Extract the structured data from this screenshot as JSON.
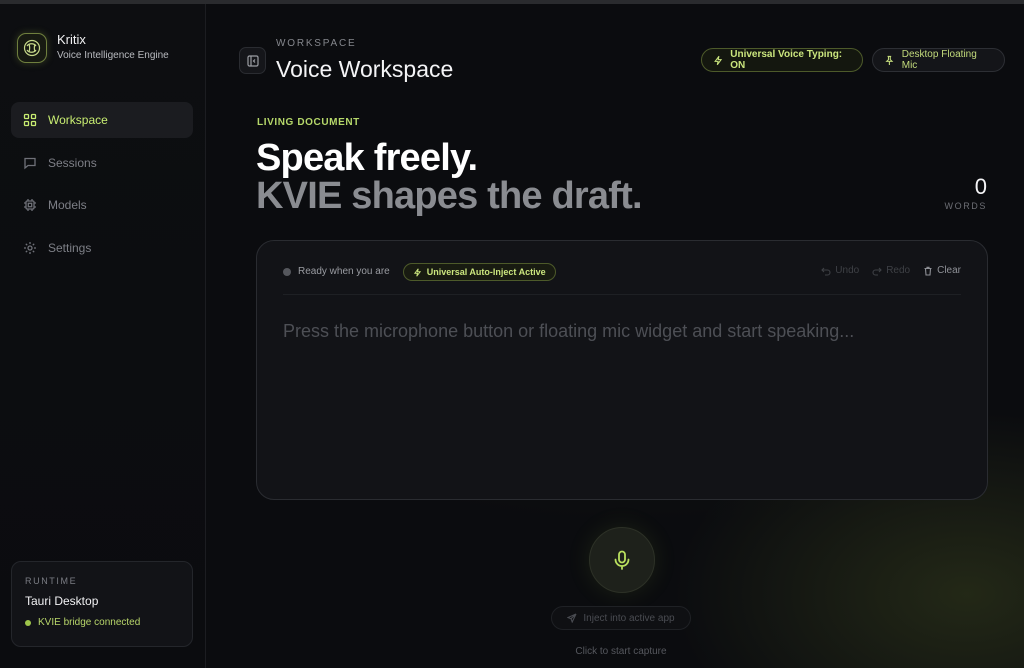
{
  "brand": {
    "name": "Kritix",
    "subtitle": "Voice Intelligence Engine"
  },
  "sidebar": {
    "items": [
      {
        "label": "Workspace",
        "icon": "grid-icon",
        "active": true
      },
      {
        "label": "Sessions",
        "icon": "chat-icon",
        "active": false
      },
      {
        "label": "Models",
        "icon": "chip-icon",
        "active": false
      },
      {
        "label": "Settings",
        "icon": "gear-icon",
        "active": false
      }
    ]
  },
  "runtime": {
    "label": "RUNTIME",
    "title": "Tauri Desktop",
    "status": "KVIE bridge connected"
  },
  "header": {
    "eyebrow": "WORKSPACE",
    "title": "Voice Workspace",
    "voice_typing": "Universal Voice Typing: ON",
    "floating_mic": "Desktop Floating Mic"
  },
  "hero": {
    "eyebrow": "LIVING DOCUMENT",
    "line1": "Speak freely.",
    "line2": "KVIE shapes the draft."
  },
  "word_count": {
    "value": "0",
    "label": "WORDS"
  },
  "editor": {
    "status": "Ready when you are",
    "badge": "Universal Auto-Inject Active",
    "undo": "Undo",
    "redo": "Redo",
    "clear": "Clear",
    "placeholder": "Press the microphone button or floating mic widget and start speaking..."
  },
  "capture": {
    "inject_label": "Inject into active app",
    "hint": "Click to start capture"
  },
  "colors": {
    "accent": "#c9ee72",
    "background": "#0b0c0f",
    "panel": "#121317"
  }
}
